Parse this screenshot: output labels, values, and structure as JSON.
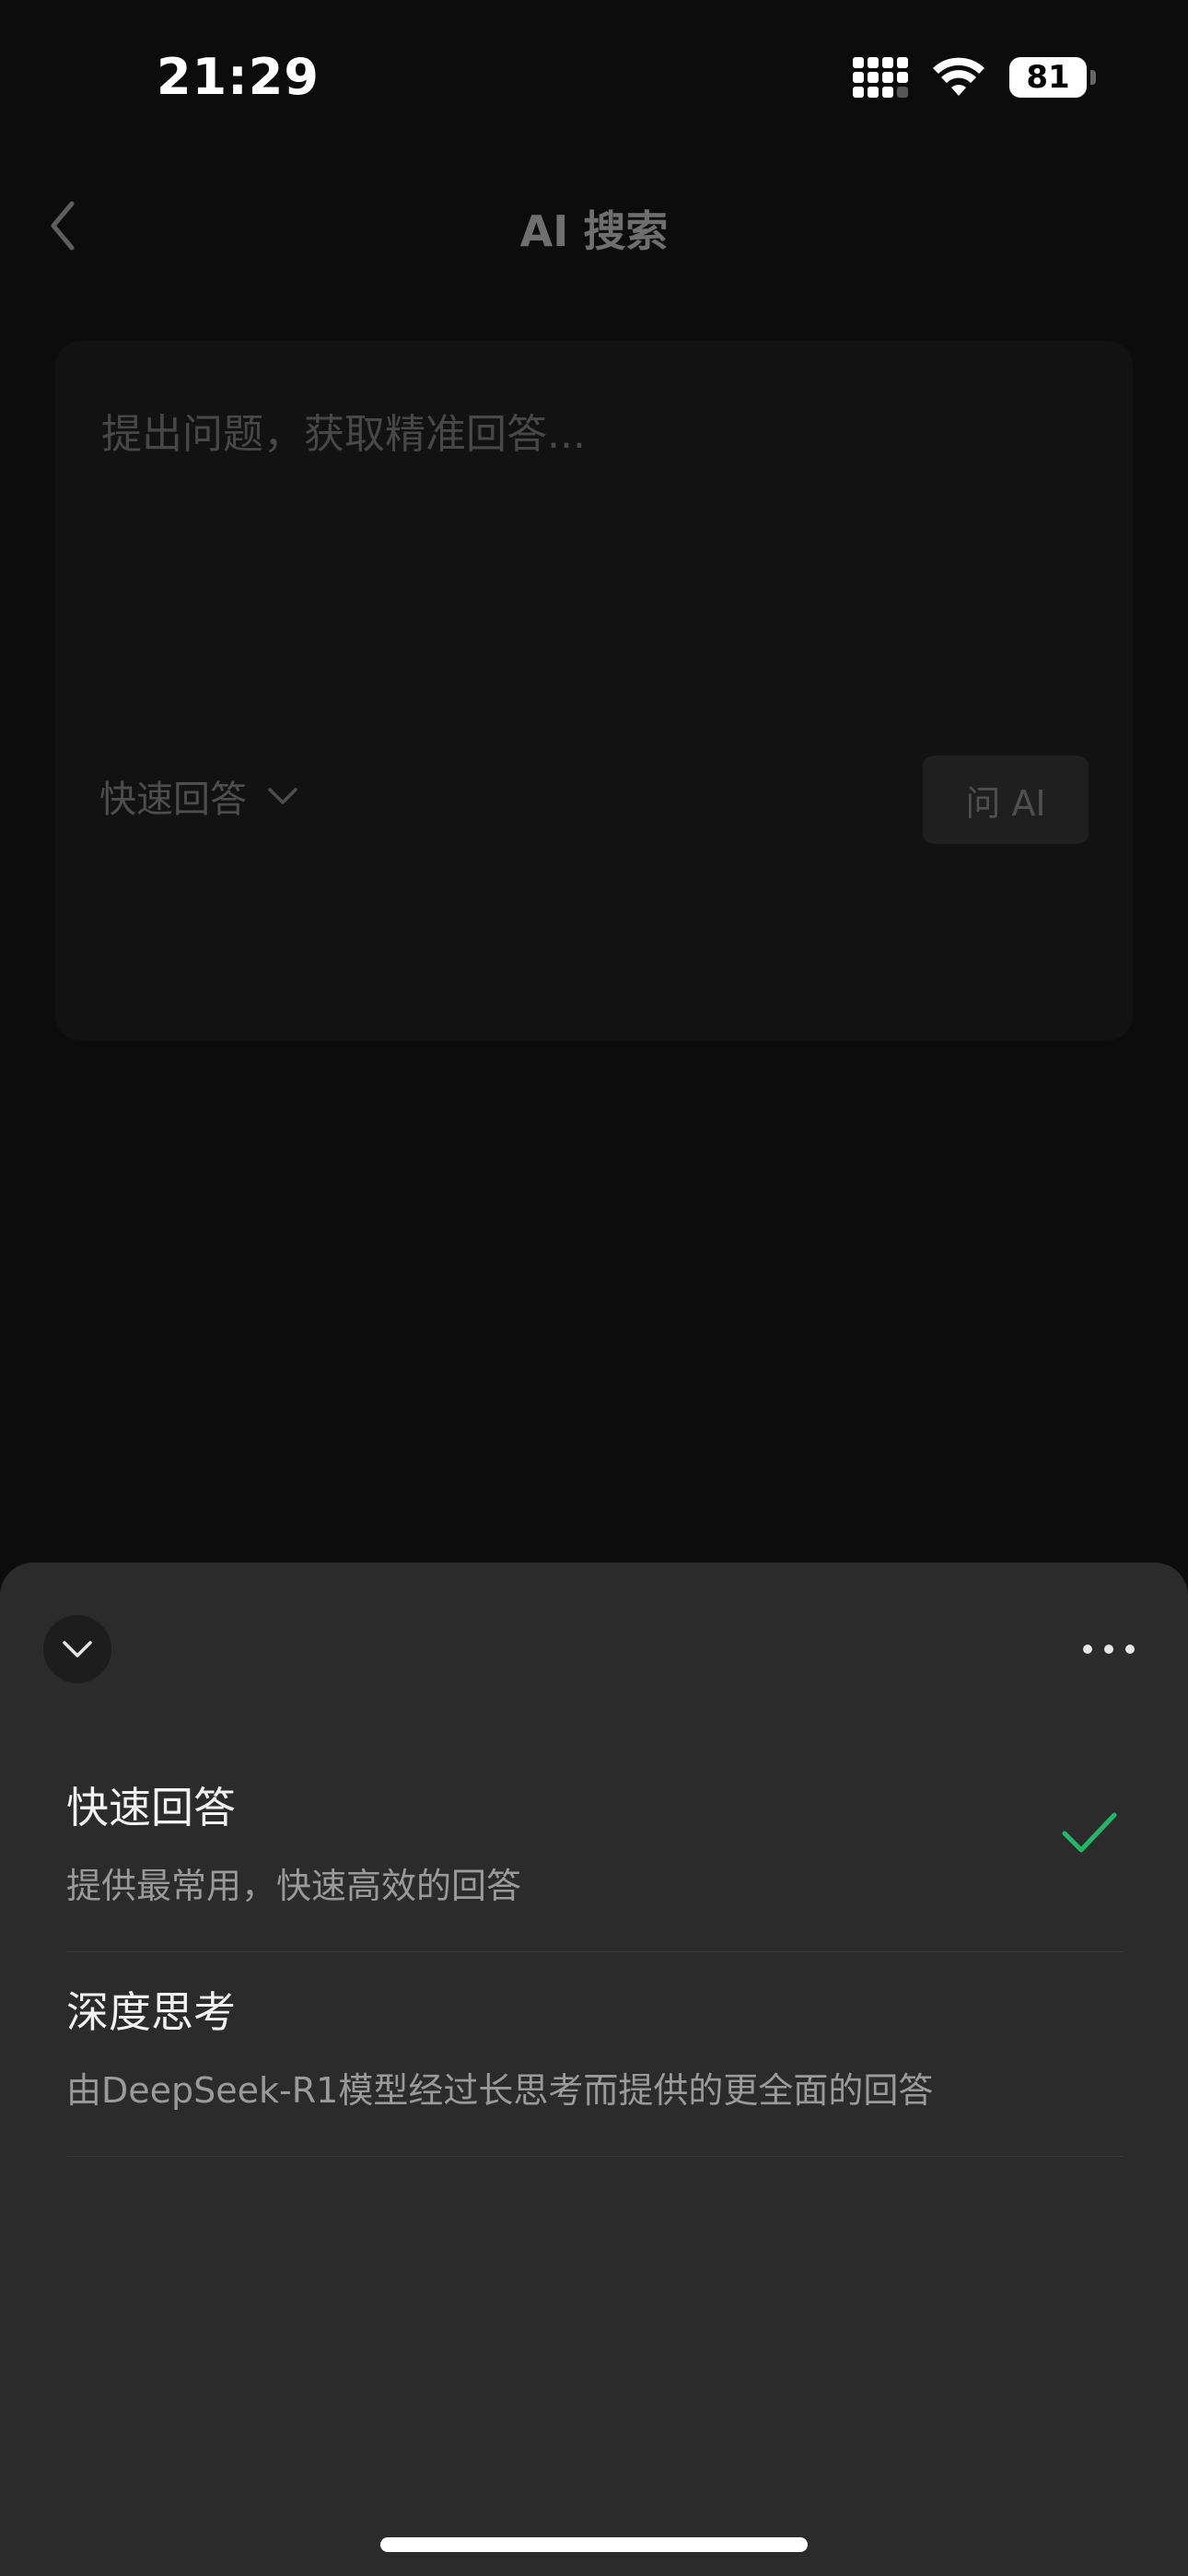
{
  "status_bar": {
    "time": "21:29",
    "battery_level": "81",
    "icons": [
      "cellular-signal-icon",
      "wifi-icon",
      "battery-icon"
    ]
  },
  "nav": {
    "title": "AI 搜索",
    "back_icon": "chevron-left-icon"
  },
  "search": {
    "placeholder": "提出问题，获取精准回答...",
    "mode_label": "快速回答",
    "ask_button": "问 AI"
  },
  "sheet": {
    "collapse_icon": "chevron-down-icon",
    "more_icon": "more-horizontal-icon",
    "options": [
      {
        "title": "快速回答",
        "description": "提供最常用，快速高效的回答",
        "selected": true
      },
      {
        "title": "深度思考",
        "description": "由DeepSeek-R1模型经过长思考而提供的更全面的回答",
        "selected": false
      }
    ]
  },
  "colors": {
    "background": "#0c0c0c",
    "sheet": "#2b2b2b",
    "accent_check": "#1fb866"
  }
}
